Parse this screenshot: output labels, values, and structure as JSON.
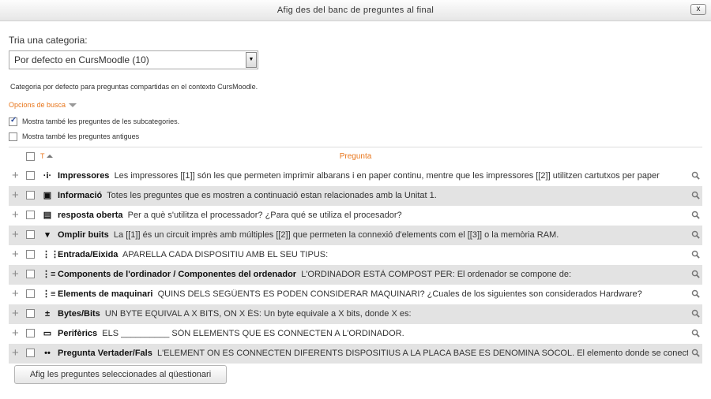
{
  "dialog": {
    "title": "Afig des del banc de preguntes al final",
    "close_label": "x"
  },
  "category": {
    "label": "Tria una categoria:",
    "selected": "Por defecto en CursMoodle (10)",
    "description": "Categoria por defecto para preguntas compartidas en el contexto CursMoodle."
  },
  "search": {
    "toggle_label": "Opcions de busca",
    "subcategories_label": "Mostra també les preguntes de les subcategories.",
    "subcategories_checked": true,
    "old_label": "Mostra també les preguntes antigues",
    "old_checked": false
  },
  "table": {
    "col_type": "T",
    "col_question": "Pregunta",
    "rows": [
      {
        "icon": "multichoice-icon",
        "glyph": "·i·",
        "name": "Impressores",
        "text": "Les impressores [[1]] són les que permeten imprimir albarans i en paper continu, mentre que les impressores [[2]] utilitzen cartutxos per paper"
      },
      {
        "icon": "description-icon",
        "glyph": "▣",
        "name": "Informació",
        "text": "Totes les preguntes que es mostren a continuació estan relacionades amb la Unitat 1."
      },
      {
        "icon": "essay-icon",
        "glyph": "▤",
        "name": "resposta oberta",
        "text": "Per a què s'utilitza el processador? ¿Para qué se utiliza el procesador?"
      },
      {
        "icon": "gapselect-icon",
        "glyph": "▾",
        "name": "Omplir buits",
        "text": "La [[1]] és un circuit imprès amb múltiples [[2]] que permeten la connexió d'elements com el [[3]] o la memòria RAM."
      },
      {
        "icon": "match-icon",
        "glyph": "⋮⋮",
        "name": "Entrada/Eixida",
        "text": "APARELLA CADA DISPOSITIU AMB EL SEU TIPUS:"
      },
      {
        "icon": "multichoice-list-icon",
        "glyph": "⋮≡",
        "name": "Components de l'ordinador / Componentes del ordenador",
        "text": "L'ORDINADOR ESTÀ COMPOST PER: El ordenador se compone de:"
      },
      {
        "icon": "multichoice-list-icon",
        "glyph": "⋮≡",
        "name": "Elements de maquinari",
        "text": "QUINS DELS SEGÜENTS ES PODEN CONSIDERAR MAQUINARI? ¿Cuales de los siguientes son considerados Hardware?"
      },
      {
        "icon": "numerical-icon",
        "glyph": "±",
        "name": "Bytes/Bits",
        "text": "UN BYTE EQUIVAL A X BITS, ON X ÉS: Un byte equivale a X bits, donde X es:"
      },
      {
        "icon": "shortanswer-icon",
        "glyph": "▭",
        "name": "Perifèrics",
        "text": "ELS __________ SÓN ELEMENTS QUE ES CONNECTEN A L'ORDINADOR."
      },
      {
        "icon": "truefalse-icon",
        "glyph": "••",
        "name": "Pregunta Vertader/Fals",
        "text": "L'ELEMENT ON ES CONNECTEN DIFERENTS DISPOSITIUS A LA PLACA BASE ES DENOMINA SÒCOL. El elemento donde se conectan"
      }
    ]
  },
  "footer": {
    "add_button": "Afig les preguntes seleccionades al qüestionari"
  }
}
